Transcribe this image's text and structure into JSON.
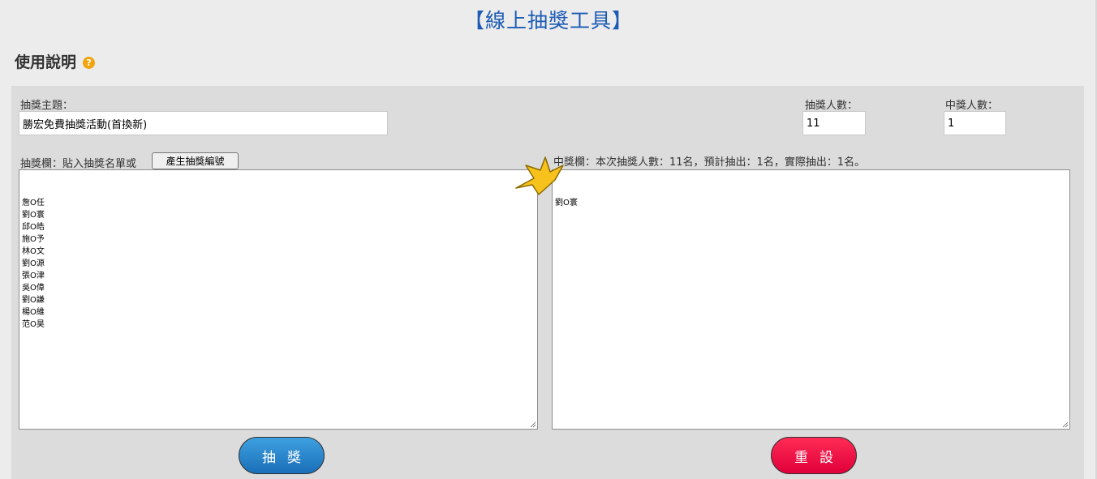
{
  "page_title": "【線上抽獎工具】",
  "help": {
    "heading": "使用說明",
    "icon": "question-circle-icon",
    "icon_glyph": "?"
  },
  "form": {
    "topic_label": "抽獎主題：",
    "topic_value": "勝宏免費抽獎活動(首換新)",
    "draw_count_label": "抽獎人數：",
    "draw_count_value": "11",
    "winner_count_label": "中獎人數：",
    "winner_count_value": "1"
  },
  "entries": {
    "label": "抽獎欄：貼入抽獎名單或",
    "generate_button": "產生抽獎編號",
    "names": [
      "詹O任",
      "劉O寰",
      "邱O皓",
      "施O予",
      "林O文",
      "劉O源",
      "張O津",
      "吳O偉",
      "劉O謙",
      "楊O維",
      "范O昊"
    ]
  },
  "winners": {
    "label": "中獎欄：本次抽獎人數：11名，預計抽出：1名，實際抽出：1名。",
    "names": [
      "劉O寰"
    ],
    "crown_icon": "crown-icon"
  },
  "buttons": {
    "draw": "抽獎",
    "reset": "重設"
  },
  "colors": {
    "title": "#1c5bb5",
    "draw_button": "#2a86cf",
    "reset_button": "#f0083f",
    "help_icon": "#f1a40d"
  }
}
